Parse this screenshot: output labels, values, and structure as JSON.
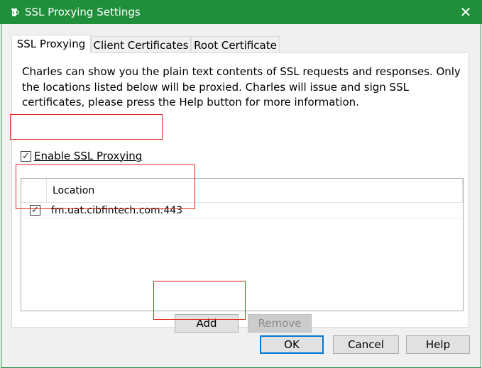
{
  "window": {
    "title": "SSL Proxying Settings",
    "close_glyph": "✕",
    "app_icon": "charles-jug-icon",
    "title_bar_color": "#1f8f3a"
  },
  "tabs": [
    {
      "label": "SSL Proxying",
      "active": true
    },
    {
      "label": "Client Certificates",
      "active": false
    },
    {
      "label": "Root Certificate",
      "active": false
    }
  ],
  "panel": {
    "description": "Charles can show you the plain text contents of SSL requests and responses. Only the locations listed below will be proxied. Charles will issue and sign SSL certificates, please press the Help button for more information.",
    "enable_checkbox": {
      "label": "Enable SSL Proxying",
      "checked": true,
      "mark": "✓"
    },
    "table": {
      "columns": [
        "",
        "Location"
      ],
      "rows": [
        {
          "enabled": true,
          "mark": "✓",
          "location": "fm.uat.cibfintech.com:443"
        }
      ]
    },
    "buttons": {
      "add": "Add",
      "remove": "Remove"
    }
  },
  "footer": {
    "ok": "OK",
    "cancel": "Cancel",
    "help": "Help"
  },
  "annotation_color": "#e0251b"
}
